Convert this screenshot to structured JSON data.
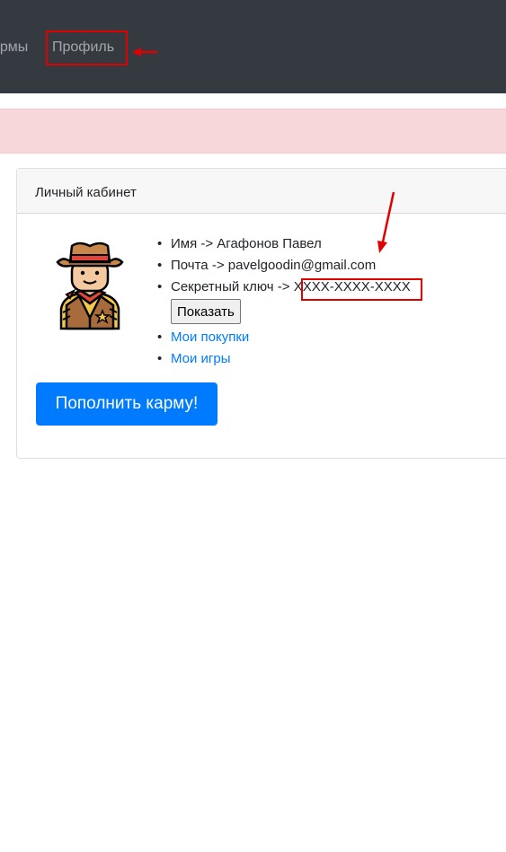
{
  "navbar": {
    "karma_link": "армы",
    "profile_link": "Профиль"
  },
  "card": {
    "header": "Личный кабинет",
    "name_line": "Имя -> Агафонов Павел",
    "email_line": "Почта -> pavelgoodin@gmail.com",
    "secret_label": "Секретный ключ -> ",
    "secret_value": "XXXX-XXXX-XXXX",
    "show_button": "Показать",
    "purchases_link": "Мои покупки",
    "games_link": "Мои игры",
    "topup_button": "Пополнить карму!"
  },
  "colors": {
    "navbar_bg": "#343a40",
    "alert_bg": "#f8d7da",
    "primary": "#007bff",
    "annotation": "#e00000"
  }
}
